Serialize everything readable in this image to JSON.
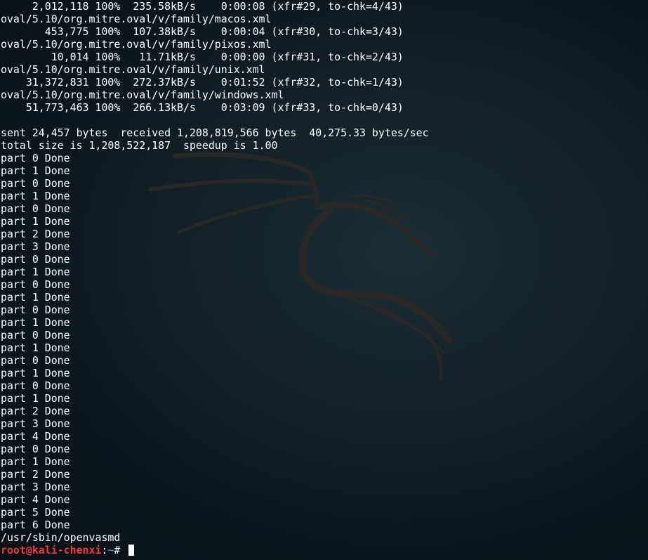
{
  "terminal": {
    "lines": [
      "     2,012,118 100%  235.58kB/s    0:00:08 (xfr#29, to-chk=4/43)",
      "oval/5.10/org.mitre.oval/v/family/macos.xml",
      "       453,775 100%  107.38kB/s    0:00:04 (xfr#30, to-chk=3/43)",
      "oval/5.10/org.mitre.oval/v/family/pixos.xml",
      "        10,014 100%   11.71kB/s    0:00:00 (xfr#31, to-chk=2/43)",
      "oval/5.10/org.mitre.oval/v/family/unix.xml",
      "    31,372,831 100%  272.37kB/s    0:01:52 (xfr#32, to-chk=1/43)",
      "oval/5.10/org.mitre.oval/v/family/windows.xml",
      "    51,773,463 100%  266.13kB/s    0:03:09 (xfr#33, to-chk=0/43)",
      "",
      "sent 24,457 bytes  received 1,208,819,566 bytes  40,275.33 bytes/sec",
      "total size is 1,208,522,187  speedup is 1.00",
      "part 0 Done",
      "part 1 Done",
      "part 0 Done",
      "part 1 Done",
      "part 0 Done",
      "part 1 Done",
      "part 2 Done",
      "part 3 Done",
      "part 0 Done",
      "part 1 Done",
      "part 0 Done",
      "part 1 Done",
      "part 0 Done",
      "part 1 Done",
      "part 0 Done",
      "part 1 Done",
      "part 0 Done",
      "part 1 Done",
      "part 0 Done",
      "part 1 Done",
      "part 2 Done",
      "part 3 Done",
      "part 4 Done",
      "part 0 Done",
      "part 1 Done",
      "part 2 Done",
      "part 3 Done",
      "part 4 Done",
      "part 5 Done",
      "part 6 Done",
      "/usr/sbin/openvasmd"
    ],
    "prompt": {
      "user_host": "root@kali-chenxi",
      "separator": ":",
      "path": "~",
      "symbol": "# "
    }
  },
  "colors": {
    "background": "#132229",
    "text": "#ffffff",
    "prompt_user": "#f03a3a",
    "prompt_path": "#3b8eea"
  },
  "icons": {
    "wallpaper": "kali-dragon-icon"
  }
}
